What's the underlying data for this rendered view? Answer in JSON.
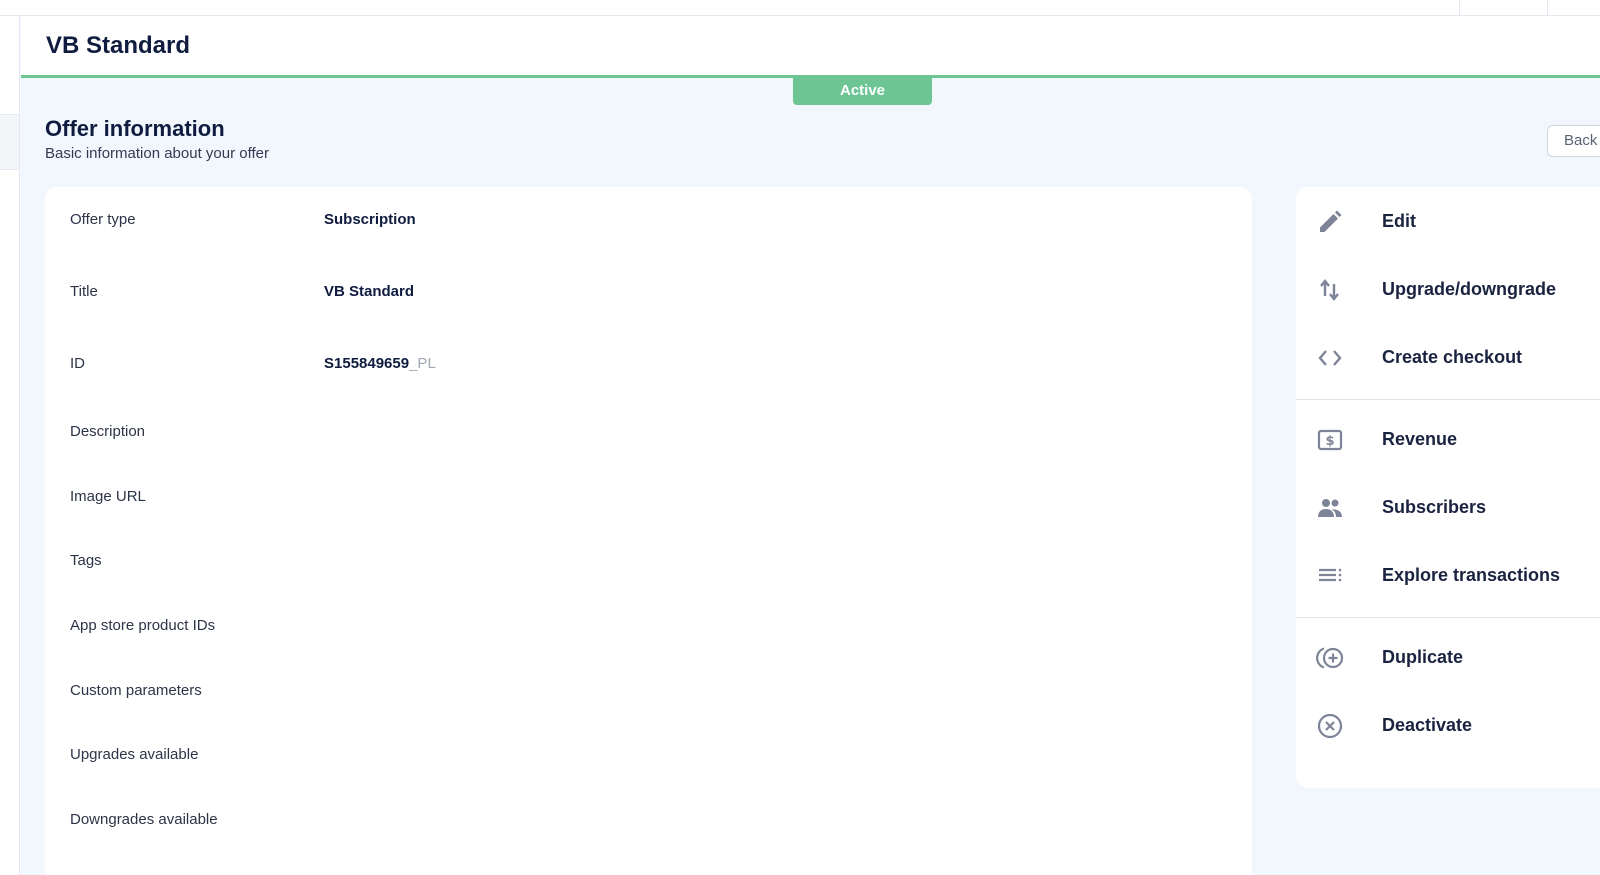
{
  "header": {
    "title": "VB Standard",
    "status": "Active"
  },
  "section": {
    "title": "Offer information",
    "subtitle": "Basic information about your offer",
    "back_label": "Back"
  },
  "info": [
    {
      "label": "Offer type",
      "value": "Subscription",
      "suffix": ""
    },
    {
      "label": "Title",
      "value": "VB Standard",
      "suffix": ""
    },
    {
      "label": "ID",
      "value": "S155849659",
      "suffix": "_PL"
    },
    {
      "label": "Description",
      "value": "",
      "suffix": ""
    },
    {
      "label": "Image URL",
      "value": "",
      "suffix": ""
    },
    {
      "label": "Tags",
      "value": "",
      "suffix": ""
    },
    {
      "label": "App store product IDs",
      "value": "",
      "suffix": ""
    },
    {
      "label": "Custom parameters",
      "value": "",
      "suffix": ""
    },
    {
      "label": "Upgrades available",
      "value": "",
      "suffix": ""
    },
    {
      "label": "Downgrades available",
      "value": "",
      "suffix": ""
    }
  ],
  "actions": [
    {
      "label": "Edit",
      "icon": "pencil-icon"
    },
    {
      "label": "Upgrade/downgrade",
      "icon": "arrows-up-down-icon"
    },
    {
      "label": "Create checkout",
      "icon": "code-icon"
    },
    {
      "label": "Revenue",
      "icon": "dollar-bill-icon"
    },
    {
      "label": "Subscribers",
      "icon": "people-icon"
    },
    {
      "label": "Explore transactions",
      "icon": "list-icon"
    },
    {
      "label": "Duplicate",
      "icon": "duplicate-plus-icon"
    },
    {
      "label": "Deactivate",
      "icon": "close-circle-icon"
    }
  ],
  "colors": {
    "accent_green": "#6cc593",
    "background": "#f2f6fd",
    "text_dark": "#0f1c3f",
    "icon_gray": "#7d8497"
  }
}
